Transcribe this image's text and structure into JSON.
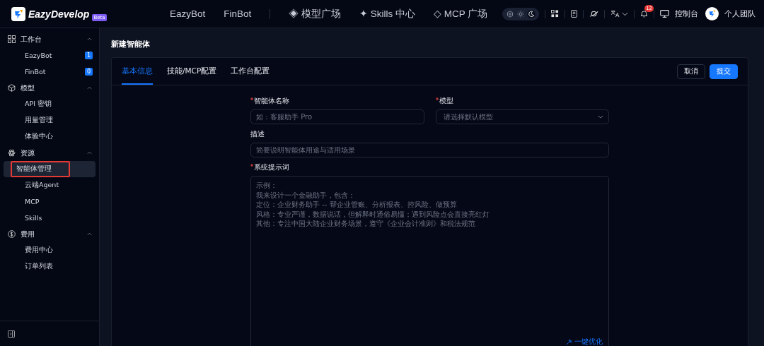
{
  "header": {
    "brand": "EazyDevelop",
    "badge": "Beta",
    "nav": [
      {
        "label": "EazyBot",
        "kind": "plain"
      },
      {
        "label": "FinBot",
        "kind": "plain"
      },
      {
        "kind": "divider"
      },
      {
        "label": "◈ 模型广场",
        "kind": "plain"
      },
      {
        "label": "✦ Skills 中心",
        "kind": "plain"
      },
      {
        "label": "◇ MCP 广场",
        "kind": "plain"
      }
    ],
    "theme_toggle": [
      {
        "kind": "system",
        "selected": false
      },
      {
        "kind": "light",
        "selected": false
      },
      {
        "kind": "dark",
        "selected": true
      }
    ],
    "notifications": "12",
    "console": "控制台",
    "team": "个人团队"
  },
  "sidebar": {
    "groups": [
      {
        "label": "工作台",
        "expanded": true,
        "items": [
          {
            "label": "EazyBot",
            "badge": "1",
            "selected": false,
            "highlighted": false
          },
          {
            "label": "FinBot",
            "badge": "0",
            "selected": false,
            "highlighted": false
          }
        ]
      },
      {
        "label": "模型",
        "expanded": true,
        "items": [
          {
            "label": "API 密钥",
            "selected": false,
            "highlighted": false
          },
          {
            "label": "用量管理",
            "selected": false,
            "highlighted": false
          },
          {
            "label": "体验中心",
            "selected": false,
            "highlighted": false
          }
        ]
      },
      {
        "label": "资源",
        "expanded": true,
        "items": [
          {
            "label": "智能体管理",
            "selected": true,
            "highlighted": true
          },
          {
            "label": "云端Agent",
            "selected": false,
            "highlighted": false
          },
          {
            "label": "MCP",
            "selected": false,
            "highlighted": false
          },
          {
            "label": "Skills",
            "selected": false,
            "highlighted": false
          }
        ]
      },
      {
        "label": "费用",
        "expanded": true,
        "items": [
          {
            "label": "费用中心",
            "selected": false,
            "highlighted": false
          },
          {
            "label": "订单列表",
            "selected": false,
            "highlighted": false
          }
        ]
      }
    ]
  },
  "page": {
    "title": "新建智能体",
    "tabs": [
      {
        "label": "基本信息",
        "selected": true
      },
      {
        "label": "技能/MCP配置",
        "selected": false
      },
      {
        "label": "工作台配置",
        "selected": false
      }
    ],
    "buttons": [
      {
        "label": "取消",
        "kind": "secondary"
      },
      {
        "label": "提交",
        "kind": "primary"
      }
    ],
    "form": {
      "name": {
        "label": "智能体名称",
        "required": true,
        "placeholder": "如：客服助手 Pro"
      },
      "model": {
        "label": "模型",
        "required": true,
        "placeholder": "请选择默认模型"
      },
      "description": {
        "label": "描述",
        "placeholder": "简要说明智能体用途与适用场景"
      },
      "system_prompt": {
        "label": "系统提示词",
        "required": true,
        "placeholder": [
          "示例：",
          "我来设计一个金融助手，包含：",
          "定位：企业财务助手 -- 帮企业管账、分析报表、控风险、做预算",
          "风格：专业严谨，数据说话，但解释时通俗易懂；遇到风险点会直接亮红灯",
          "其他：专注中国大陆企业财务场景，遵守《企业会计准则》和税法规范"
        ],
        "action": "一键优化"
      }
    }
  }
}
